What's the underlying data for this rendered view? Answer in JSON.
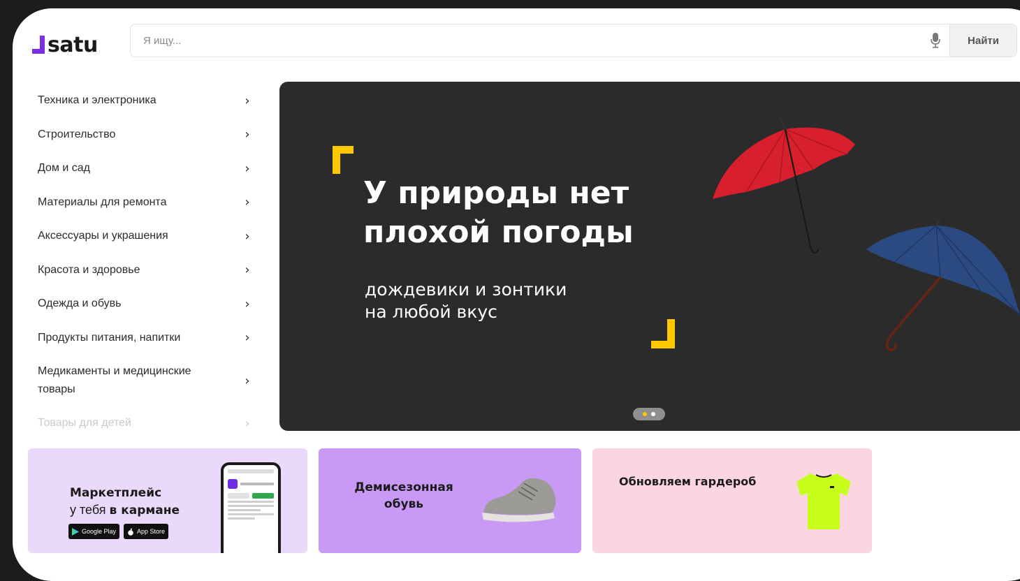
{
  "brand": {
    "logo_text": "satu",
    "accent_color": "#7b2fe0"
  },
  "search": {
    "placeholder": "Я ищу...",
    "value": "",
    "button_label": "Найти",
    "mic_icon": "microphone-icon"
  },
  "sidebar": {
    "items": [
      {
        "label": "Техника и электроника"
      },
      {
        "label": "Строительство"
      },
      {
        "label": "Дом и сад"
      },
      {
        "label": "Материалы для ремонта"
      },
      {
        "label": "Аксессуары и украшения"
      },
      {
        "label": "Красота и здоровье"
      },
      {
        "label": "Одежда и обувь"
      },
      {
        "label": "Продукты питания, напитки"
      },
      {
        "label": "Медикаменты и медицинские товары"
      },
      {
        "label": "Товары для детей"
      }
    ],
    "arrow_glyph": "›"
  },
  "banner": {
    "title": "У природы нет плохой погоды",
    "subtitle_line1": "дождевики и зонтики",
    "subtitle_line2": "на любой вкус",
    "background": "#2b2b2b",
    "accent": "#ffc800",
    "slides": 2,
    "active_slide": 1
  },
  "promos": {
    "app": {
      "title_line1": "Маркетплейс",
      "title_line2_prefix": "у тебя ",
      "title_line2_bold": "в кармане",
      "google_play": "Google Play",
      "app_store": "App Store",
      "background": "#ead9fb"
    },
    "shoes": {
      "title_line1": "Демисезонная",
      "title_line2": "обувь",
      "background": "#c89af5"
    },
    "clothes": {
      "title": "Обновляем гардероб",
      "background": "#fbd6e0"
    }
  }
}
